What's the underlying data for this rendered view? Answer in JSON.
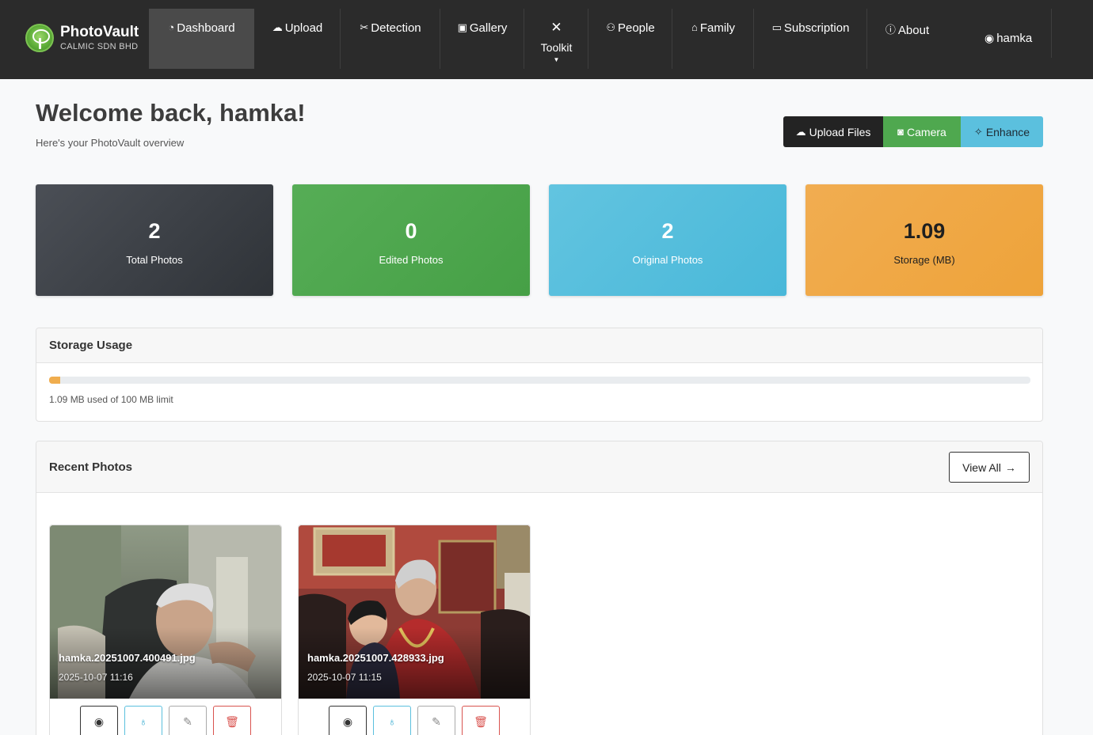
{
  "brand": {
    "name": "PhotoVault",
    "subtitle": "CALMIC SDN BHD"
  },
  "nav": {
    "dashboard": {
      "label": "Dashboard",
      "icon": "gauge-icon"
    },
    "upload": {
      "label": "Upload",
      "icon": "cloud-upload-icon"
    },
    "detection": {
      "label": "Detection",
      "icon": "scissors-icon"
    },
    "gallery": {
      "label": "Gallery",
      "icon": "images-icon"
    },
    "toolkit": {
      "label": "Toolkit",
      "icon": "tools-icon"
    },
    "people": {
      "label": "People",
      "icon": "people-icon"
    },
    "family": {
      "label": "Family",
      "icon": "house-heart-icon"
    },
    "subscription": {
      "label": "Subscription",
      "icon": "credit-card-icon"
    },
    "about": {
      "label": "About",
      "icon": "info-circle-icon"
    },
    "user": {
      "label": "hamka",
      "icon": "person-circle-icon"
    }
  },
  "header": {
    "welcome": "Welcome back, hamka!",
    "subtitle": "Here's your PhotoVault overview"
  },
  "actions": {
    "upload_files": "Upload Files",
    "camera": "Camera",
    "enhance": "Enhance"
  },
  "stats": [
    {
      "value": "2",
      "label": "Total Photos"
    },
    {
      "value": "0",
      "label": "Edited Photos"
    },
    {
      "value": "2",
      "label": "Original Photos"
    },
    {
      "value": "1.09",
      "label": "Storage (MB)"
    }
  ],
  "storage": {
    "title": "Storage Usage",
    "used_fraction": 0.0109,
    "text": "1.09 MB used of 100 MB limit"
  },
  "recent": {
    "title": "Recent Photos",
    "view_all": "View All",
    "photos": [
      {
        "name": "hamka.20251007.400491.jpg",
        "date": "2025-10-07 11:16"
      },
      {
        "name": "hamka.20251007.428933.jpg",
        "date": "2025-10-07 11:15"
      }
    ]
  },
  "colors": {
    "navbar": "#2b2b2b",
    "dark": "#232323",
    "success": "#4fa84f",
    "info": "#5bc0de",
    "warning": "#f0ad4e",
    "danger": "#d9534f"
  }
}
